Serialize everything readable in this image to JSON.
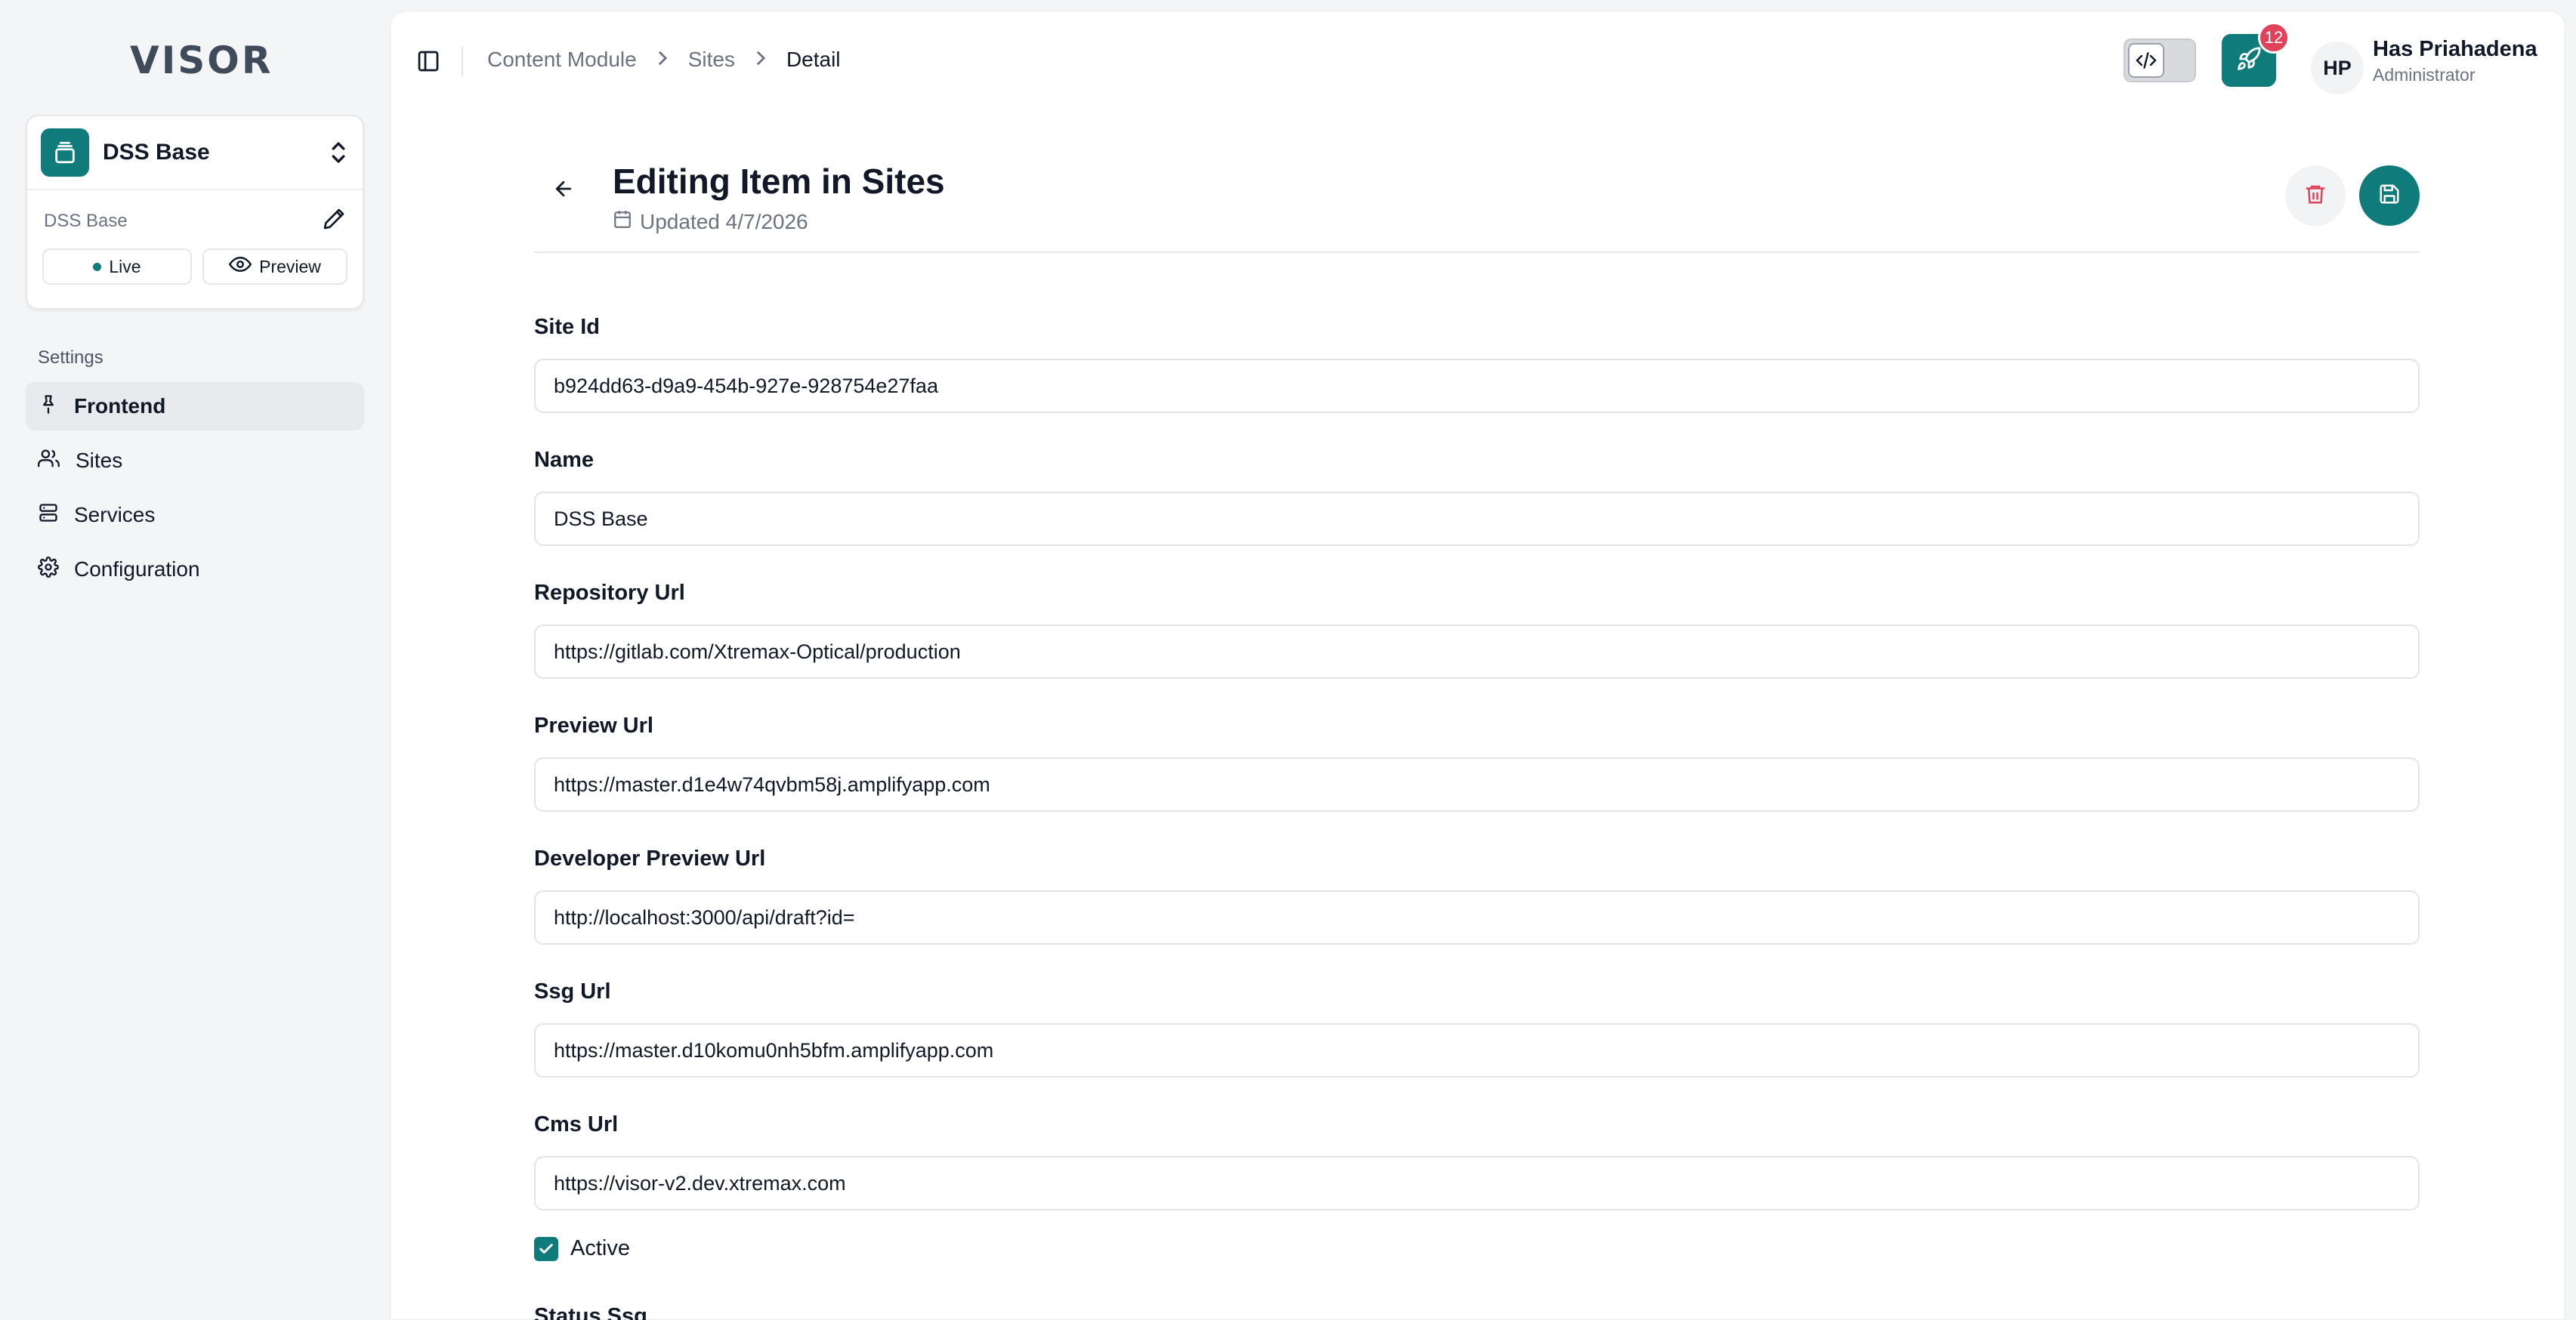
{
  "app": {
    "logo_text": "VISOR"
  },
  "site_selector": {
    "name": "DSS Base",
    "sub_label": "DSS Base",
    "live_label": "Live",
    "preview_label": "Preview"
  },
  "sidebar": {
    "section_title": "Settings",
    "items": [
      {
        "label": "Frontend",
        "icon": "pin-icon",
        "active": true
      },
      {
        "label": "Sites",
        "icon": "users-icon",
        "active": false
      },
      {
        "label": "Services",
        "icon": "server-icon",
        "active": false
      },
      {
        "label": "Configuration",
        "icon": "gear-icon",
        "active": false
      }
    ]
  },
  "breadcrumb": [
    "Content Module",
    "Sites",
    "Detail"
  ],
  "header": {
    "notification_count": "12",
    "user_initials": "HP",
    "user_name": "Has Priahadena",
    "user_role": "Administrator"
  },
  "page": {
    "title": "Editing Item in Sites",
    "updated": "Updated 4/7/2026"
  },
  "fields": [
    {
      "label": "Site Id",
      "value": "b924dd63-d9a9-454b-927e-928754e27faa"
    },
    {
      "label": "Name",
      "value": "DSS Base"
    },
    {
      "label": "Repository Url",
      "value": "https://gitlab.com/Xtremax-Optical/production"
    },
    {
      "label": "Preview Url",
      "value": "https://master.d1e4w74qvbm58j.amplifyapp.com"
    },
    {
      "label": "Developer Preview Url",
      "value": "http://localhost:3000/api/draft?id="
    },
    {
      "label": "Ssg Url",
      "value": "https://master.d10komu0nh5bfm.amplifyapp.com"
    },
    {
      "label": "Cms Url",
      "value": "https://visor-v2.dev.xtremax.com"
    }
  ],
  "active": {
    "label": "Active",
    "checked": true
  },
  "status_ssg": {
    "label": "Status Ssg"
  },
  "colors": {
    "accent": "#0f7b7b",
    "badge": "#e0425a",
    "danger": "#e0425a"
  }
}
